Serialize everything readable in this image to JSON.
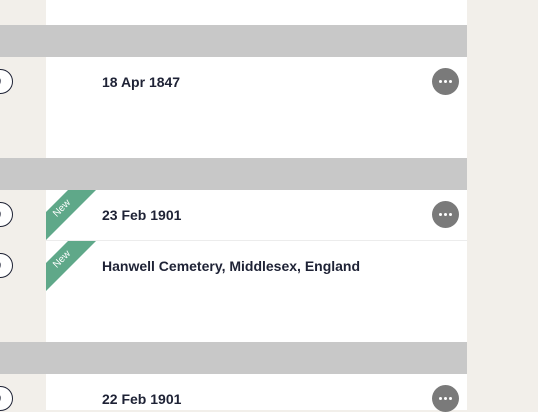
{
  "rows": [
    {
      "text": "18 Apr 1847"
    },
    {
      "text": "23 Feb 1901",
      "badge": "New"
    },
    {
      "text": "Hanwell Cemetery, Middlesex, England",
      "badge": "New"
    },
    {
      "text": "22 Feb 1901"
    }
  ],
  "icons": {
    "more": "more-horizontal-icon",
    "expand": "hint-circle-icon"
  },
  "colors": {
    "band": "#c8c8c8",
    "background": "#f2efea",
    "ribbon": "#5fa889",
    "more_button": "#7a7a7a",
    "text": "#1e2235"
  }
}
